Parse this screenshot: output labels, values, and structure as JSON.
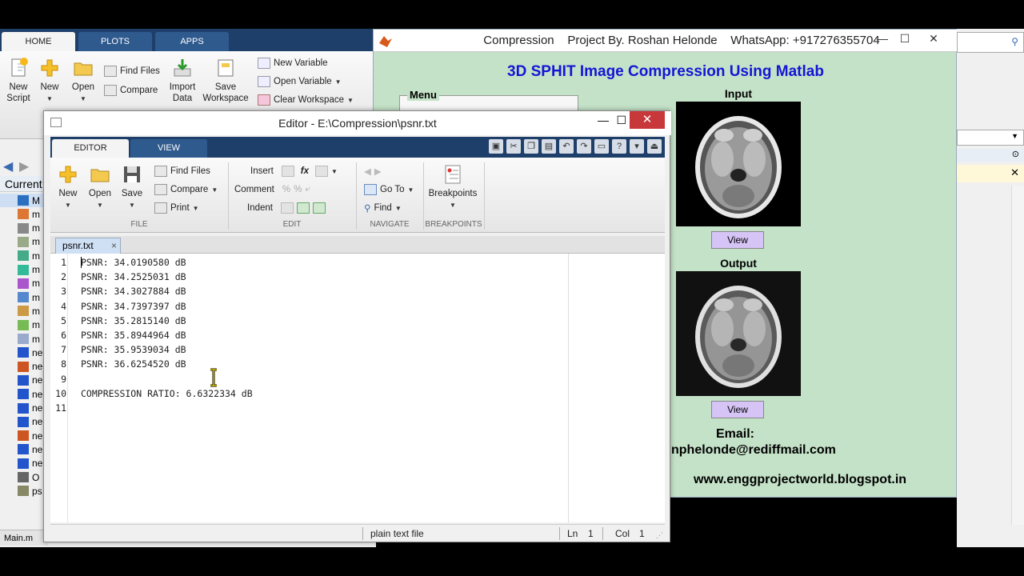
{
  "main_window": {
    "tabs": [
      "HOME",
      "PLOTS",
      "APPS"
    ],
    "toolstrip": {
      "new_script": "New\nScript",
      "new": "New",
      "open": "Open",
      "find_files": "Find Files",
      "compare": "Compare",
      "import_data": "Import\nData",
      "save_workspace": "Save\nWorkspace",
      "new_variable": "New Variable",
      "open_variable": "Open Variable",
      "clear_workspace": "Clear Workspace"
    },
    "current_folder_label": "Current",
    "files": [
      "M",
      "m",
      "m",
      "m",
      "m",
      "m",
      "m",
      "m",
      "m",
      "m",
      "m",
      "ne",
      "ne",
      "ne",
      "ne",
      "ne",
      "ne",
      "ne",
      "ne",
      "ne",
      "O",
      "ps"
    ],
    "status_file": "Main.m"
  },
  "gui": {
    "title": "Compression    Project By. Roshan Helonde    WhatsApp: +917276355704",
    "heading": "3D SPHIT Image Compression Using Matlab",
    "menu_label": "Menu",
    "input_label": "Input",
    "output_label": "Output",
    "view_label": "View",
    "email_label": "Email:",
    "email_value": "nphelonde@rediffmail.com",
    "website": "www.enggprojectworld.blogspot.in"
  },
  "editor": {
    "title": "Editor - E:\\Compression\\psnr.txt",
    "tabs": [
      "EDITOR",
      "VIEW"
    ],
    "toolstrip": {
      "new": "New",
      "open": "Open",
      "save": "Save",
      "find_files": "Find Files",
      "compare": "Compare",
      "print": "Print",
      "insert": "Insert",
      "comment": "Comment",
      "indent": "Indent",
      "go_to": "Go To",
      "find": "Find",
      "breakpoints": "Breakpoints",
      "groups": [
        "FILE",
        "EDIT",
        "NAVIGATE",
        "BREAKPOINTS"
      ]
    },
    "document_tab": "psnr.txt",
    "lines": [
      "PSNR: 34.0190580 dB",
      "PSNR: 34.2525031 dB",
      "PSNR: 34.3027884 dB",
      "PSNR: 34.7397397 dB",
      "PSNR: 35.2815140 dB",
      "PSNR: 35.8944964 dB",
      "PSNR: 35.9539034 dB",
      "PSNR: 36.6254520 dB",
      "",
      "COMPRESSION RATIO: 6.6322334 dB",
      ""
    ],
    "status": {
      "file_type": "plain text file",
      "ln_label": "Ln",
      "ln_value": "1",
      "col_label": "Col",
      "col_value": "1"
    }
  }
}
